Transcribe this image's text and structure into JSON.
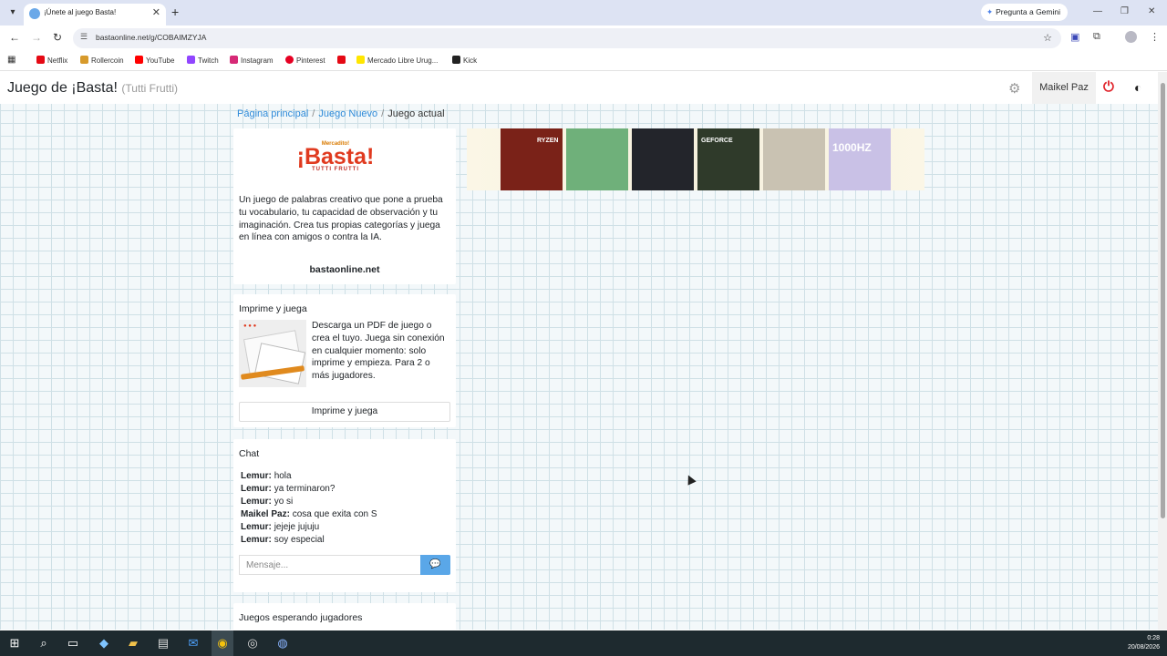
{
  "browser": {
    "tab_title": "¡Únete al juego Basta!",
    "gemini_label": "Pregunta a Gemini",
    "url": "bastaonline.net/g/COBAIMZYJA",
    "bookmarks": [
      "Netflix",
      "Rollercoin",
      "YouTube",
      "Twitch",
      "Instagram",
      "Pinterest",
      "Mercado Libre Urug...",
      "Kick"
    ]
  },
  "navbar": {
    "brand": "Juego de ¡Basta!",
    "brand_sub": "(Tutti Frutti)",
    "user": "Maikel Paz"
  },
  "breadcrumb": {
    "home": "Página principal",
    "new_game": "Juego Nuevo",
    "current": "Juego actual"
  },
  "intro": {
    "logo_top": "Mercadito!",
    "logo_main": "¡Basta!",
    "logo_sub": "TUTTI FRUTTI",
    "text": "Un juego de palabras creativo que pone a prueba tu vocabulario, tu capacidad de observación y tu imaginación. Crea tus propias categorías y juega en línea con amigos o contra la IA.",
    "site": "bastaonline.net"
  },
  "print": {
    "title": "Imprime y juega",
    "text": "Descarga un PDF de juego o crea el tuyo. Juega sin conexión en cualquier momento: solo imprime y empieza. Para 2 o más jugadores.",
    "button": "Imprime y juega"
  },
  "chat": {
    "title": "Chat",
    "messages": [
      {
        "user": "Lemur:",
        "text": "hola"
      },
      {
        "user": "Lemur:",
        "text": "ya terminaron?"
      },
      {
        "user": "Lemur:",
        "text": "yo si"
      },
      {
        "user": "Maikel Paz:",
        "text": "cosa que exita con S"
      },
      {
        "user": "Lemur:",
        "text": "jejeje jujuju"
      },
      {
        "user": "Lemur:",
        "text": "soy especial"
      }
    ],
    "placeholder": "Mensaje..."
  },
  "waiting": {
    "title": "Juegos esperando jugadores"
  },
  "ads": [
    {
      "label": "RYZEN",
      "color": "#7a2218"
    },
    {
      "label": "",
      "color": "#6fb07a"
    },
    {
      "label": "",
      "color": "#23252b"
    },
    {
      "label": "GEFORCE",
      "color": "#2f3a2a"
    },
    {
      "label": "",
      "color": "#c9c2b2"
    },
    {
      "label": "1000HZ",
      "color": "#c9c1e6"
    }
  ],
  "taskbar": {
    "time": "0:28",
    "date": "20/08/2026"
  }
}
